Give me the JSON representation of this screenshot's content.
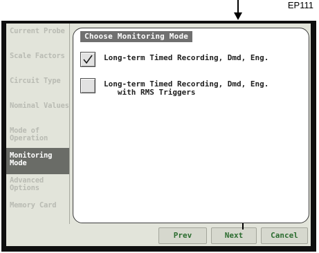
{
  "figure_label": "EP111",
  "sidebar": {
    "items": [
      {
        "label": "Current Probe"
      },
      {
        "label": "Scale Factors"
      },
      {
        "label": "Circuit Type"
      },
      {
        "label": "Nominal Values"
      },
      {
        "label": "Mode of Operation"
      },
      {
        "label": "Monitoring Mode",
        "active": true
      },
      {
        "label": "Advanced Options"
      },
      {
        "label": "Memory Card"
      }
    ]
  },
  "panel": {
    "title": "Choose Monitoring Mode",
    "options": [
      {
        "label": "Long-term Timed Recording, Dmd, Eng.",
        "checked": true
      },
      {
        "label": "Long-term Timed Recording, Dmd, Eng.\n   with RMS Triggers",
        "checked": false
      }
    ]
  },
  "buttons": {
    "prev": "Prev",
    "next": "Next",
    "cancel": "Cancel"
  },
  "colors": {
    "button_text": "#2a6b2e",
    "active_sidebar_bg": "#6a6c67",
    "title_bg": "#707070"
  }
}
